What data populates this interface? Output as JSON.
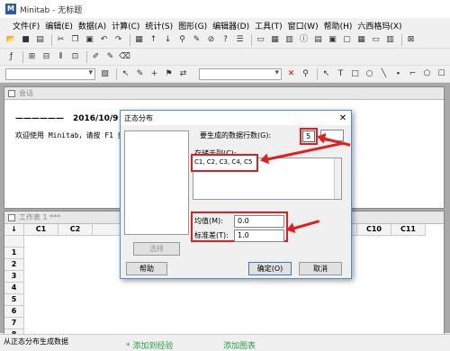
{
  "window": {
    "title": "Minitab - 无标题",
    "app_icon": "M"
  },
  "menu": [
    "文件(F)",
    "编辑(E)",
    "数据(A)",
    "计算(C)",
    "统计(S)",
    "图形(G)",
    "编辑器(D)",
    "工具(T)",
    "窗口(W)",
    "帮助(H)",
    "六西格玛(X)"
  ],
  "session": {
    "title": "会话",
    "line1_dashes": "——————",
    "line1_date": "2016/10/9",
    "line2": "欢迎使用 Minitab，请按 F1 获得"
  },
  "worksheet": {
    "title": "工作表 1 ***",
    "columns": [
      "C1",
      "C2",
      "",
      "",
      "",
      "",
      "",
      "",
      "",
      "C9",
      "C10",
      "C11"
    ],
    "rows": [
      "1",
      "2",
      "3",
      "4",
      "5",
      "6",
      "7",
      "8"
    ],
    "corner": "↓"
  },
  "dialog": {
    "title": "正态分布",
    "rows_label": "要生成的数据行数(G):",
    "rows_value": "5",
    "store_label": "存储于列(C):",
    "store_value": "C1, C2, C3, C4, C5",
    "mean_label": "均值(M):",
    "mean_value": "0.0",
    "sd_label": "标准差(T):",
    "sd_value": "1.0",
    "select_btn": "选择",
    "help_btn": "帮助",
    "ok_btn": "确定(O)",
    "cancel_btn": "取消"
  },
  "status": "从正态分布生成数据",
  "watermark": {
    "left": "* 添加到经验",
    "right": "添加图表"
  },
  "colors": {
    "highlight": "#e02020",
    "dialog_border": "#4a90d9"
  }
}
